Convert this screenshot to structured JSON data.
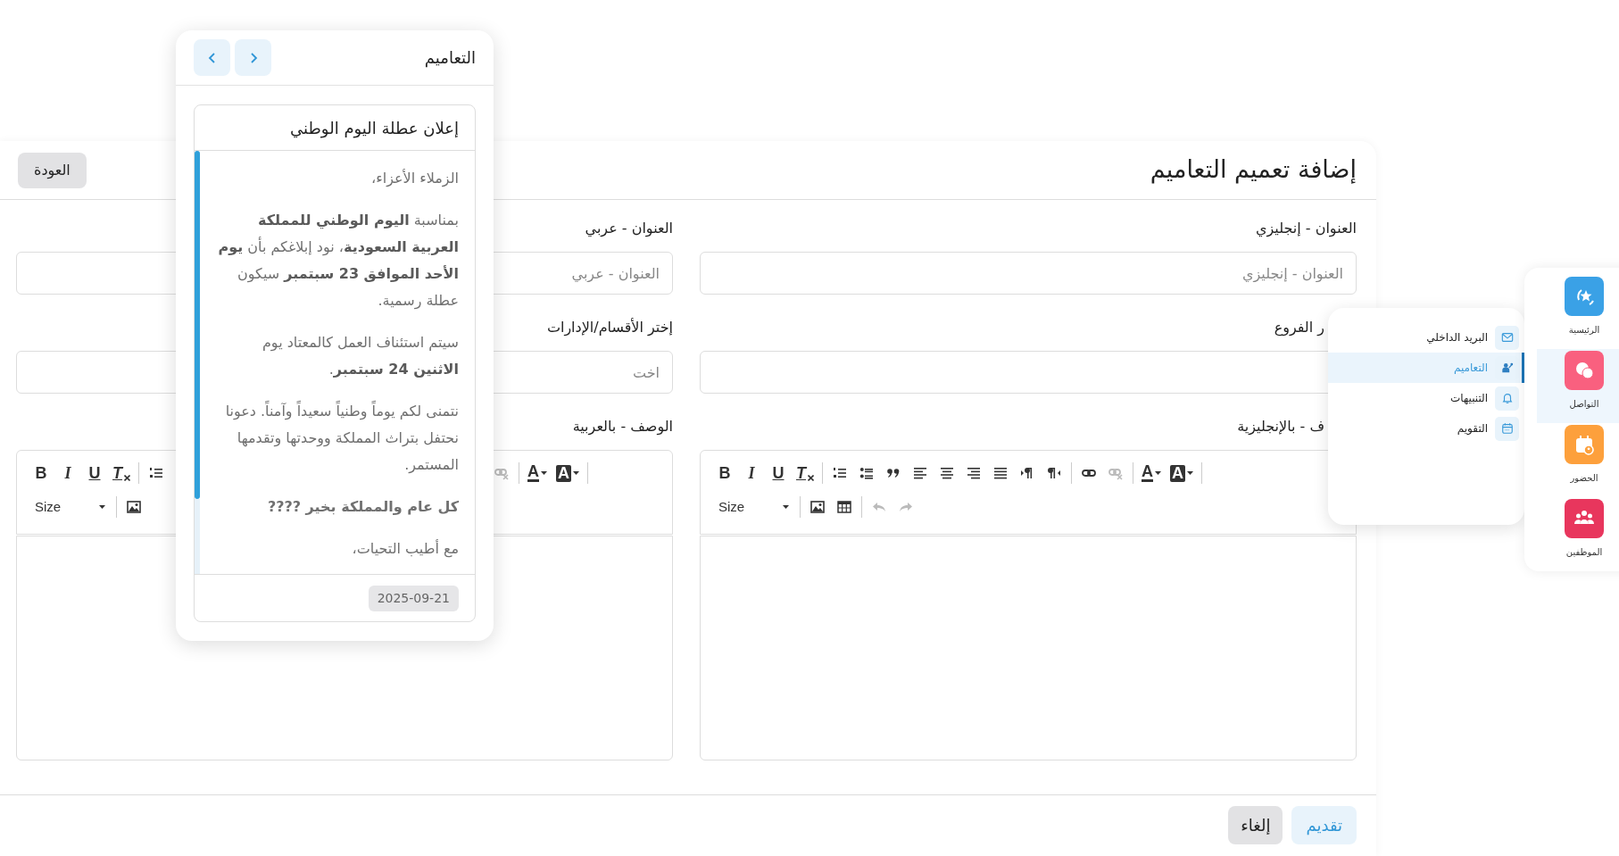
{
  "page": {
    "title": "إضافة تعميم التعاميم",
    "back_button": "العودة"
  },
  "form": {
    "fields": [
      {
        "kind": "input",
        "label": "العنوان - إنجليزي",
        "placeholder": "العنوان - إنجليزي"
      },
      {
        "kind": "input",
        "label": "العنوان - عربي",
        "placeholder": "العنوان - عربي"
      },
      {
        "kind": "select",
        "label": "ر الفروع"
      },
      {
        "kind": "select",
        "label": "إختر الأقسام/الإدارات",
        "placeholder": "اخت"
      },
      {
        "kind": "editor",
        "label": "ف - بالإنجليزية",
        "toolbar": [
          {
            "left_part": [
              [
                {
                  "kind": "bgcolor",
                  "text": "A",
                  "disabled": false
                },
                {
                  "kind": "color",
                  "text": "A",
                  "disabled": false
                }
              ],
              [
                {
                  "kind": "unlink",
                  "disabled": true
                },
                {
                  "kind": "link",
                  "disabled": false
                }
              ],
              [
                {
                  "kind": "rtl",
                  "disabled": false
                },
                {
                  "kind": "ltr",
                  "disabled": false
                },
                {
                  "kind": "justify",
                  "disabled": false
                },
                {
                  "kind": "align-right",
                  "disabled": false
                },
                {
                  "kind": "align-center",
                  "disabled": false
                },
                {
                  "kind": "align-left",
                  "disabled": false
                },
                {
                  "kind": "quote",
                  "disabled": false
                },
                {
                  "kind": "ul",
                  "disabled": false
                },
                {
                  "kind": "ol",
                  "disabled": false
                }
              ],
              [
                {
                  "kind": "clear",
                  "text": "T",
                  "disabled": false
                },
                {
                  "kind": "underline",
                  "text": "U",
                  "disabled": false
                },
                {
                  "kind": "italic",
                  "text": "I",
                  "disabled": false
                },
                {
                  "kind": "bold",
                  "text": "B",
                  "disabled": false
                }
              ]
            ]
          },
          {
            "left_part": [
              [
                {
                  "kind": "redo",
                  "disabled": true
                },
                {
                  "kind": "undo",
                  "disabled": true
                }
              ],
              [
                {
                  "kind": "table",
                  "disabled": false
                },
                {
                  "kind": "image",
                  "disabled": false
                }
              ],
              [
                {
                  "kind": "size",
                  "text": "Size",
                  "disabled": false
                }
              ]
            ]
          }
        ]
      },
      {
        "kind": "editor",
        "label": "الوصف - بالعربية",
        "toolbar": [
          {
            "right_part": [
              [
                {
                  "kind": "bgcolor",
                  "text": "A",
                  "disabled": false
                },
                {
                  "kind": "color",
                  "text": "A",
                  "disabled": false
                }
              ],
              [
                {
                  "kind": "unlink",
                  "disabled": true
                }
              ]
            ],
            "left_part": [
              [
                {
                  "kind": "ol",
                  "disabled": false
                }
              ],
              [
                {
                  "kind": "clear",
                  "text": "T",
                  "disabled": false
                },
                {
                  "kind": "underline",
                  "text": "U",
                  "disabled": false
                },
                {
                  "kind": "italic",
                  "text": "I",
                  "disabled": false
                },
                {
                  "kind": "bold",
                  "text": "B",
                  "disabled": false
                }
              ]
            ]
          },
          {
            "left_part": [
              [
                {
                  "kind": "image",
                  "disabled": false
                }
              ],
              [
                {
                  "kind": "size",
                  "text": "Size",
                  "disabled": false
                }
              ]
            ]
          }
        ]
      }
    ]
  },
  "buttons": [
    {
      "kind": "submit",
      "label": "تقديم"
    },
    {
      "kind": "cancel",
      "label": "إلغاء"
    }
  ],
  "popup": {
    "title": "التعاميم",
    "card": {
      "title": "إعلان عطلة اليوم الوطني",
      "paragraphs": [
        {
          "text": "الزملاء الأعزاء،",
          "bold": false
        },
        {
          "text": "بمناسبة **اليوم الوطني للمملكة العربية السعودية**، نود إبلاغكم بأن **يوم الأحد الموافق 23 سبتمبر** سيكون عطلة رسمية.",
          "bold": false
        },
        {
          "text": "سيتم استئناف العمل كالمعتاد يوم **الاثنين 24 سبتمبر**.",
          "bold": false
        },
        {
          "text": "نتمنى لكم يوماً وطنياً سعيداً وآمناً. دعونا نحتفل بتراث المملكة ووحدتها وتقدمها المستمر.",
          "bold": false
        },
        {
          "text": "كل عام والمملكة بخير ????",
          "bold": true
        },
        {
          "text": "مع أطيب التحيات،",
          "bold": false
        }
      ],
      "date": "2025-09-21"
    }
  },
  "sidebar": {
    "items": [
      {
        "kind": "home",
        "label": "الرئيسية",
        "color": "#3aa1e6",
        "selected": false
      },
      {
        "kind": "chat",
        "label": "التواصل",
        "color": "#f9607f",
        "selected": true
      },
      {
        "kind": "attendance",
        "label": "الحضور",
        "color": "#fda03c",
        "selected": false
      },
      {
        "kind": "employees",
        "label": "الموظفين",
        "color": "#e8365d",
        "selected": false
      }
    ]
  },
  "flyout": {
    "items": [
      {
        "kind": "mail",
        "label": "البريد الداخلي",
        "selected": false
      },
      {
        "kind": "circulars",
        "label": "التعاميم",
        "selected": true
      },
      {
        "kind": "alerts",
        "label": "التنبيهات",
        "selected": false
      },
      {
        "kind": "calendar",
        "label": "التقويم",
        "selected": false
      }
    ]
  }
}
